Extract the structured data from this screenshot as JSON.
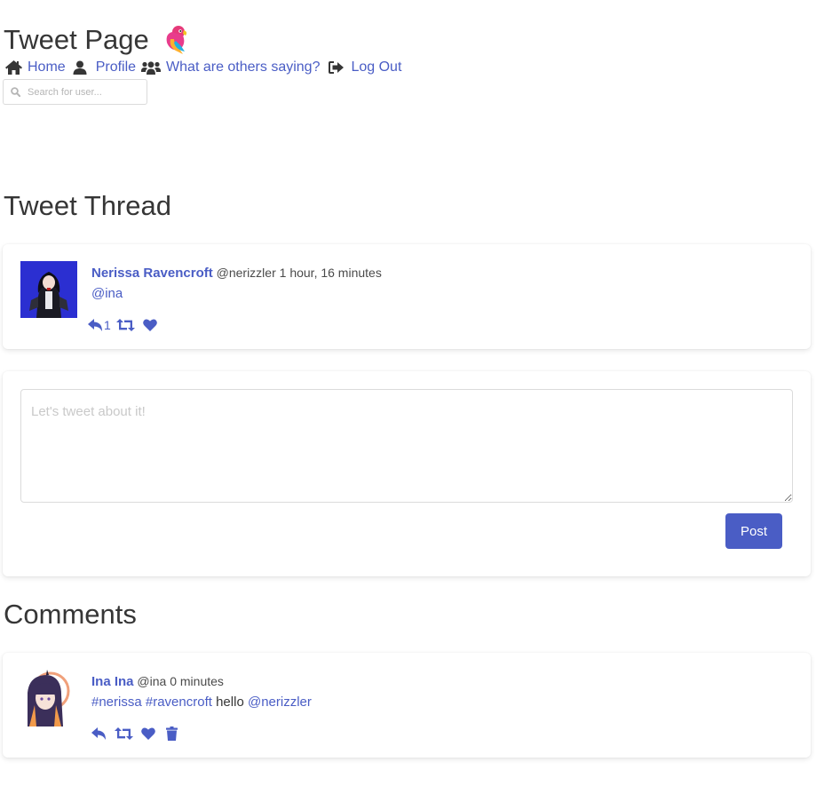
{
  "header": {
    "title": "Tweet Page",
    "logo_icon": "parrot-emoji"
  },
  "nav": {
    "items": [
      {
        "label": "Home",
        "icon": "home-icon"
      },
      {
        "label": "Profile",
        "icon": "user-icon"
      },
      {
        "label": "What are others saying?",
        "icon": "users-icon"
      },
      {
        "label": "Log Out",
        "icon": "sign-out-icon"
      }
    ]
  },
  "search": {
    "placeholder": "Search for user...",
    "value": ""
  },
  "thread": {
    "heading": "Tweet Thread",
    "tweet": {
      "author_name": "Nerissa Ravencroft",
      "handle": "@nerizzler",
      "time": "1 hour, 16 minutes",
      "mention": "@ina",
      "reply_count": "1"
    }
  },
  "compose": {
    "placeholder": "Let's tweet about it!",
    "value": "",
    "post_label": "Post"
  },
  "comments": {
    "heading": "Comments",
    "items": [
      {
        "author_name": "Ina Ina",
        "handle": "@ina",
        "time": "0 minutes",
        "tag1": "#nerissa",
        "tag2": "#ravencroft",
        "text": "hello",
        "mention": "@nerizzler"
      }
    ]
  },
  "colors": {
    "accent": "#4a5dc5",
    "heading": "#363636",
    "border": "#dbdbdb"
  }
}
